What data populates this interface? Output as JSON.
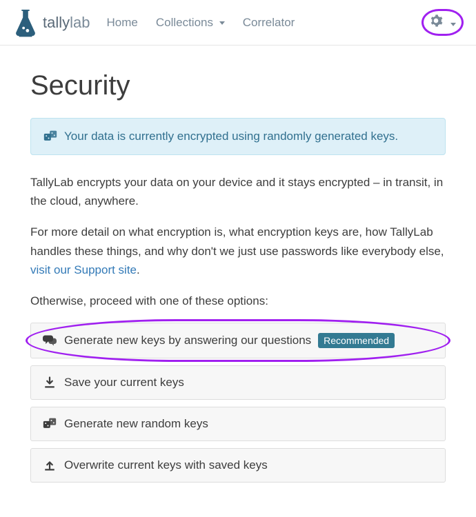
{
  "brand": {
    "name1": "tally",
    "name2": "lab"
  },
  "nav": {
    "home": "Home",
    "collections": "Collections",
    "correlator": "Correlator"
  },
  "page": {
    "title": "Security",
    "alert": "Your data is currently encrypted using randomly generated keys.",
    "para1": "TallyLab encrypts your data on your device and it stays encrypted – in transit, in the cloud, anywhere.",
    "para2a": "For more detail on what encryption is, what encryption keys are, how TallyLab handles these things, and why don't we just use passwords like everybody else, ",
    "para2link": "visit our Support site",
    "para2b": ".",
    "para3": "Otherwise, proceed with one of these options:"
  },
  "options": {
    "o1": "Generate new keys by answering our questions",
    "o1badge": "Recommended",
    "o2": "Save your current keys",
    "o3": "Generate new random keys",
    "o4": "Overwrite current keys with saved keys"
  }
}
